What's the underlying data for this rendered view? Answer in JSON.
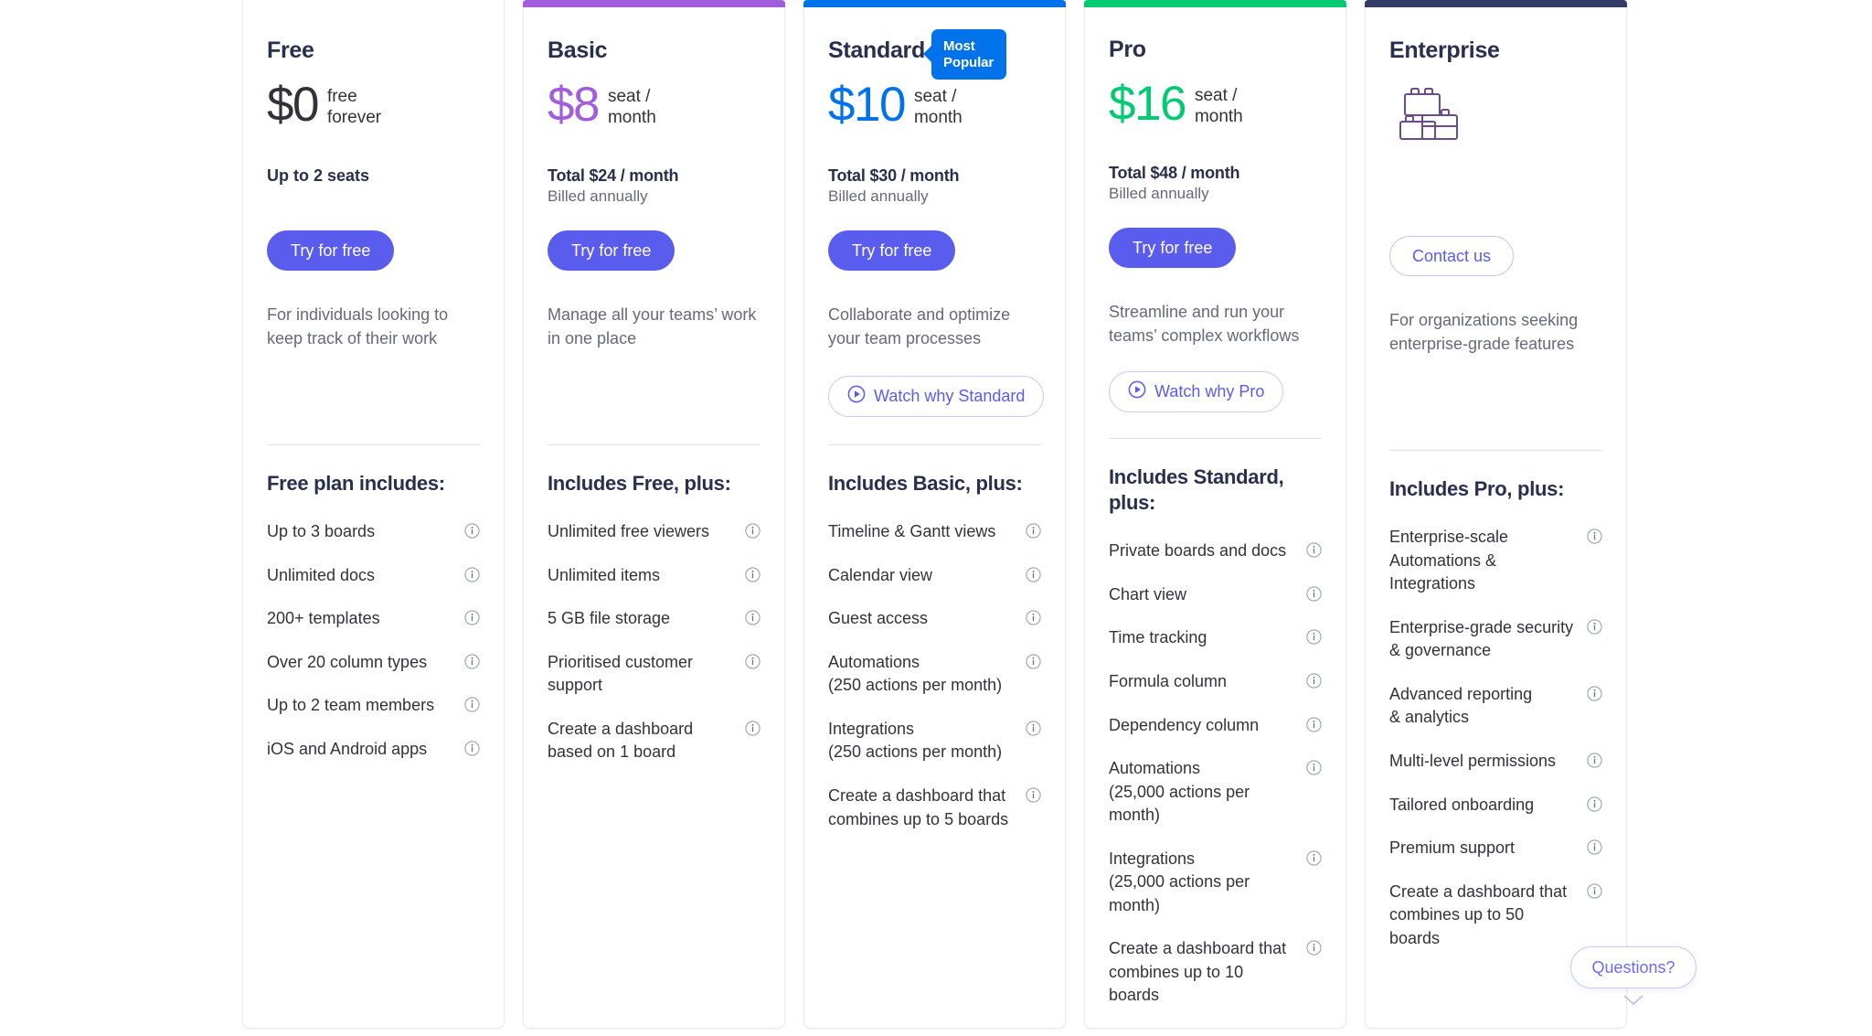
{
  "colors": {
    "free_accent": "#323338",
    "basic_accent": "#a25ddc",
    "standard_accent": "#0073ea",
    "pro_accent": "#00ca72",
    "enterprise_accent": "#333b67",
    "primary_button": "#5a5ced",
    "outline_button_text": "#5a5ced",
    "badge_bg": "#0073ea"
  },
  "plans": [
    {
      "id": "free",
      "name": "Free",
      "topbar_color": "",
      "price": "$0",
      "price_color": "#323338",
      "price_unit": "free\nforever",
      "seats": "Up to 2 seats",
      "total": "",
      "billed": "",
      "cta_label": "Try for free",
      "cta_style": "primary",
      "tagline": "For individuals looking to keep track of their work",
      "watch_label": "",
      "includes_title": "Free plan includes:",
      "features": [
        "Up to 3 boards",
        "Unlimited docs",
        "200+ templates",
        "Over 20 column types",
        "Up to 2 team members",
        "iOS and Android apps"
      ]
    },
    {
      "id": "basic",
      "name": "Basic",
      "topbar_color": "#a25ddc",
      "price": "$8",
      "price_color": "#a25ddc",
      "price_unit": "seat /\nmonth",
      "seats": "",
      "total": "Total $24 / month",
      "billed": "Billed annually",
      "cta_label": "Try for free",
      "cta_style": "primary",
      "tagline": "Manage all your teams’ work in one place",
      "watch_label": "",
      "includes_title": "Includes Free, plus:",
      "features": [
        "Unlimited free viewers",
        "Unlimited items",
        "5 GB file storage",
        "Prioritised customer support",
        "Create a dashboard based on 1 board"
      ]
    },
    {
      "id": "standard",
      "name": "Standard",
      "badge": "Most Popular",
      "topbar_color": "#0073ea",
      "price": "$10",
      "price_color": "#0073ea",
      "price_unit": "seat /\nmonth",
      "seats": "",
      "total": "Total $30 / month",
      "billed": "Billed annually",
      "cta_label": "Try for free",
      "cta_style": "primary",
      "tagline": "Collaborate and optimize your team processes",
      "watch_label": "Watch why Standard",
      "includes_title": "Includes Basic, plus:",
      "features": [
        "Timeline & Gantt views",
        "Calendar view",
        "Guest access",
        "Automations\n(250 actions per month)",
        "Integrations\n(250 actions per month)",
        "Create a dashboard that combines up to 5 boards"
      ]
    },
    {
      "id": "pro",
      "name": "Pro",
      "topbar_color": "#00ca72",
      "price": "$16",
      "price_color": "#00ca72",
      "price_unit": "seat /\nmonth",
      "seats": "",
      "total": "Total $48 / month",
      "billed": "Billed annually",
      "cta_label": "Try for free",
      "cta_style": "primary",
      "tagline": "Streamline and run your teams’ complex workflows",
      "watch_label": "Watch why Pro",
      "includes_title": "Includes Standard, plus:",
      "features": [
        "Private boards and docs",
        "Chart view",
        "Time tracking",
        "Formula column",
        "Dependency column",
        "Automations\n(25,000 actions per month)",
        "Integrations\n(25,000 actions per month)",
        "Create a dashboard that combines up to 10 boards"
      ]
    },
    {
      "id": "enterprise",
      "name": "Enterprise",
      "topbar_color": "#333b67",
      "price": "",
      "price_color": "",
      "price_unit": "",
      "seats": "",
      "total": "",
      "billed": "",
      "cta_label": "Contact us",
      "cta_style": "outline",
      "tagline": "For organizations seeking enterprise-grade features",
      "watch_label": "",
      "icon": "blocks-icon",
      "includes_title": "Includes Pro, plus:",
      "features": [
        "Enterprise-scale Automations & Integrations",
        "Enterprise-grade security\n& governance",
        "Advanced reporting\n& analytics",
        "Multi-level permissions",
        "Tailored onboarding",
        "Premium support",
        "Create a dashboard that combines up to 50 boards"
      ]
    }
  ],
  "help": {
    "questions_label": "Questions?",
    "chevron_icon": "chevron-down-icon"
  },
  "icons": {
    "info": "info-icon",
    "play": "play-icon"
  }
}
